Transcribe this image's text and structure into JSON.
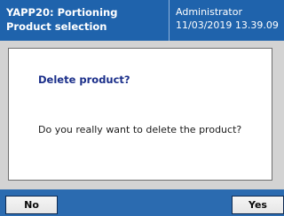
{
  "header": {
    "title": "YAPP20: Portioning",
    "subtitle": "Product selection",
    "user": "Administrator",
    "datetime": "11/03/2019 13.39.09"
  },
  "dialog": {
    "title": "Delete product?",
    "message": "Do you really want to delete the product?"
  },
  "buttons": {
    "no_label": "No",
    "yes_label": "Yes"
  },
  "colors": {
    "header_background": "#1f63ac",
    "footer_background": "#2b6bb0",
    "dialog_title": "#1b2f8a"
  }
}
